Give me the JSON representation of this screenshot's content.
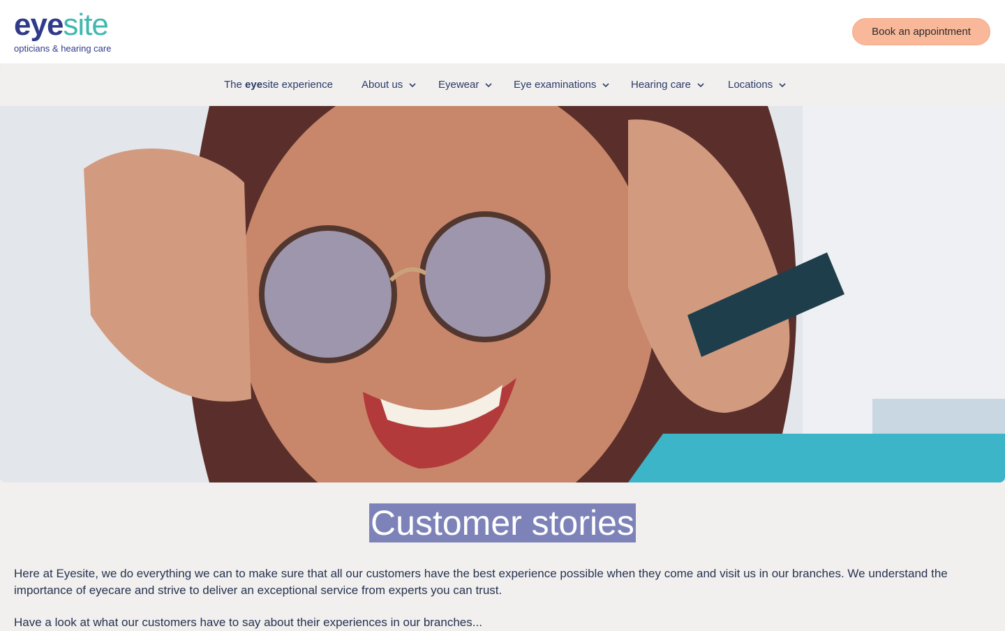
{
  "brand": {
    "name_part1": "eye",
    "name_part2": "site",
    "tagline": "opticians & hearing care"
  },
  "header": {
    "cta_label": "Book an appointment"
  },
  "nav": {
    "experience_prefix": "The ",
    "experience_bold": "eye",
    "experience_suffix": "site experience",
    "items": [
      {
        "label": "About us"
      },
      {
        "label": "Eyewear"
      },
      {
        "label": "Eye examinations"
      },
      {
        "label": "Hearing care"
      },
      {
        "label": "Locations"
      }
    ]
  },
  "hero": {
    "image_icon": "photo-woman-with-glasses"
  },
  "page": {
    "title": "Customer stories",
    "intro": "Here at Eyesite, we do everything we can to make sure that all our customers have the best experience possible when they come and visit us in our branches. We understand the importance of eyecare and strive to deliver an exceptional service from experts you can trust.",
    "intro2": "Have a look at what our customers have to say about their experiences in our branches..."
  },
  "colors": {
    "brand_navy": "#2f3b8a",
    "brand_teal": "#3fb8b0",
    "cta_peach": "#f9b89a",
    "title_highlight": "#7d83b8",
    "page_bg": "#f1f0ef"
  }
}
